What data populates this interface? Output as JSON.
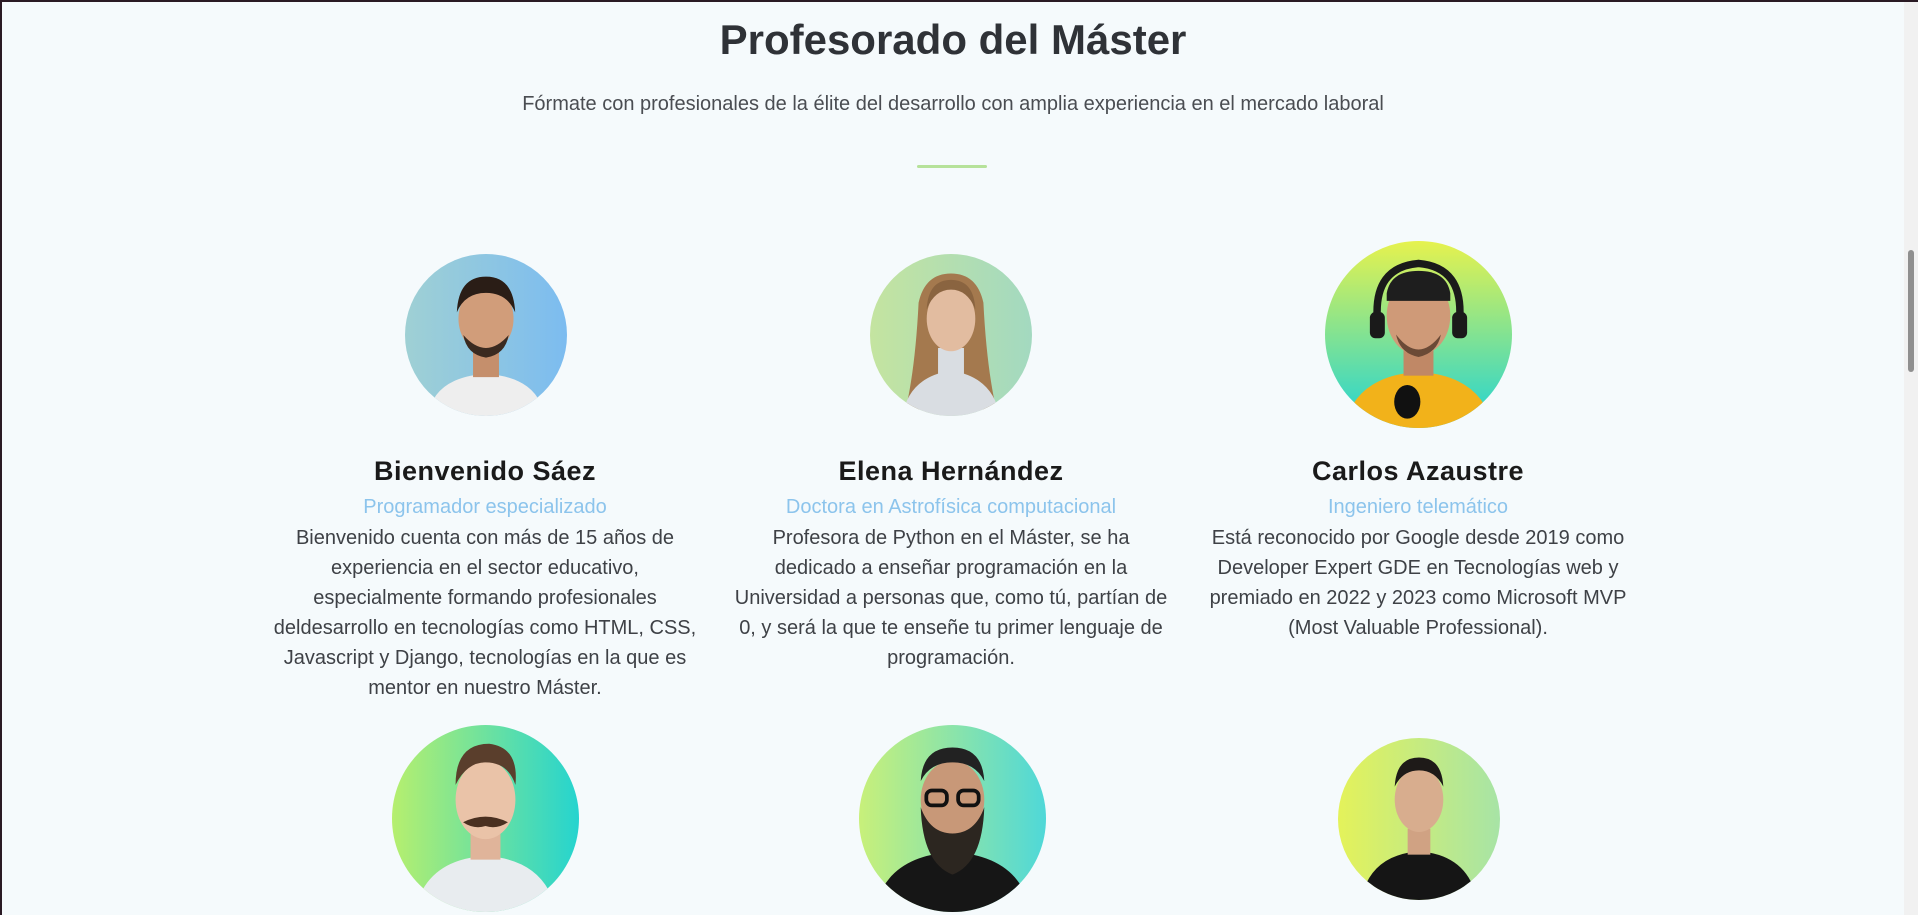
{
  "section": {
    "title": "Profesorado del Máster",
    "subtitle": "Fórmate con profesionales de la élite del desarrollo con amplia experiencia en el mercado laboral"
  },
  "teachers": [
    {
      "name": "Bienvenido Sáez",
      "role": "Programador especializado",
      "bio": "Bienvenido cuenta con más de 15 años de experiencia en el sector educativo, especialmente formando profesionales deldesarrollo en tecnologías como HTML, CSS, Javascript y Django, tecnologías en la que es mentor en nuestro Máster."
    },
    {
      "name": "Elena Hernández",
      "role": "Doctora en Astrofísica computacional",
      "bio": "Profesora de Python en el Máster, se ha dedicado a enseñar programación en la Universidad a personas que, como tú, partían de 0, y será la que te enseñe tu primer lenguaje de programación."
    },
    {
      "name": "Carlos Azaustre",
      "role": "Ingeniero telemático",
      "bio": "Está reconocido por Google desde 2019 como Developer Expert GDE en Tecnologías web y premiado en 2022 y 2023 como Microsoft MVP (Most Valuable Professional)."
    }
  ],
  "colors": {
    "page_background": "#f5fafc",
    "title": "#2f3237",
    "role": "#8cc4ec",
    "divider": "#b6e29a"
  }
}
